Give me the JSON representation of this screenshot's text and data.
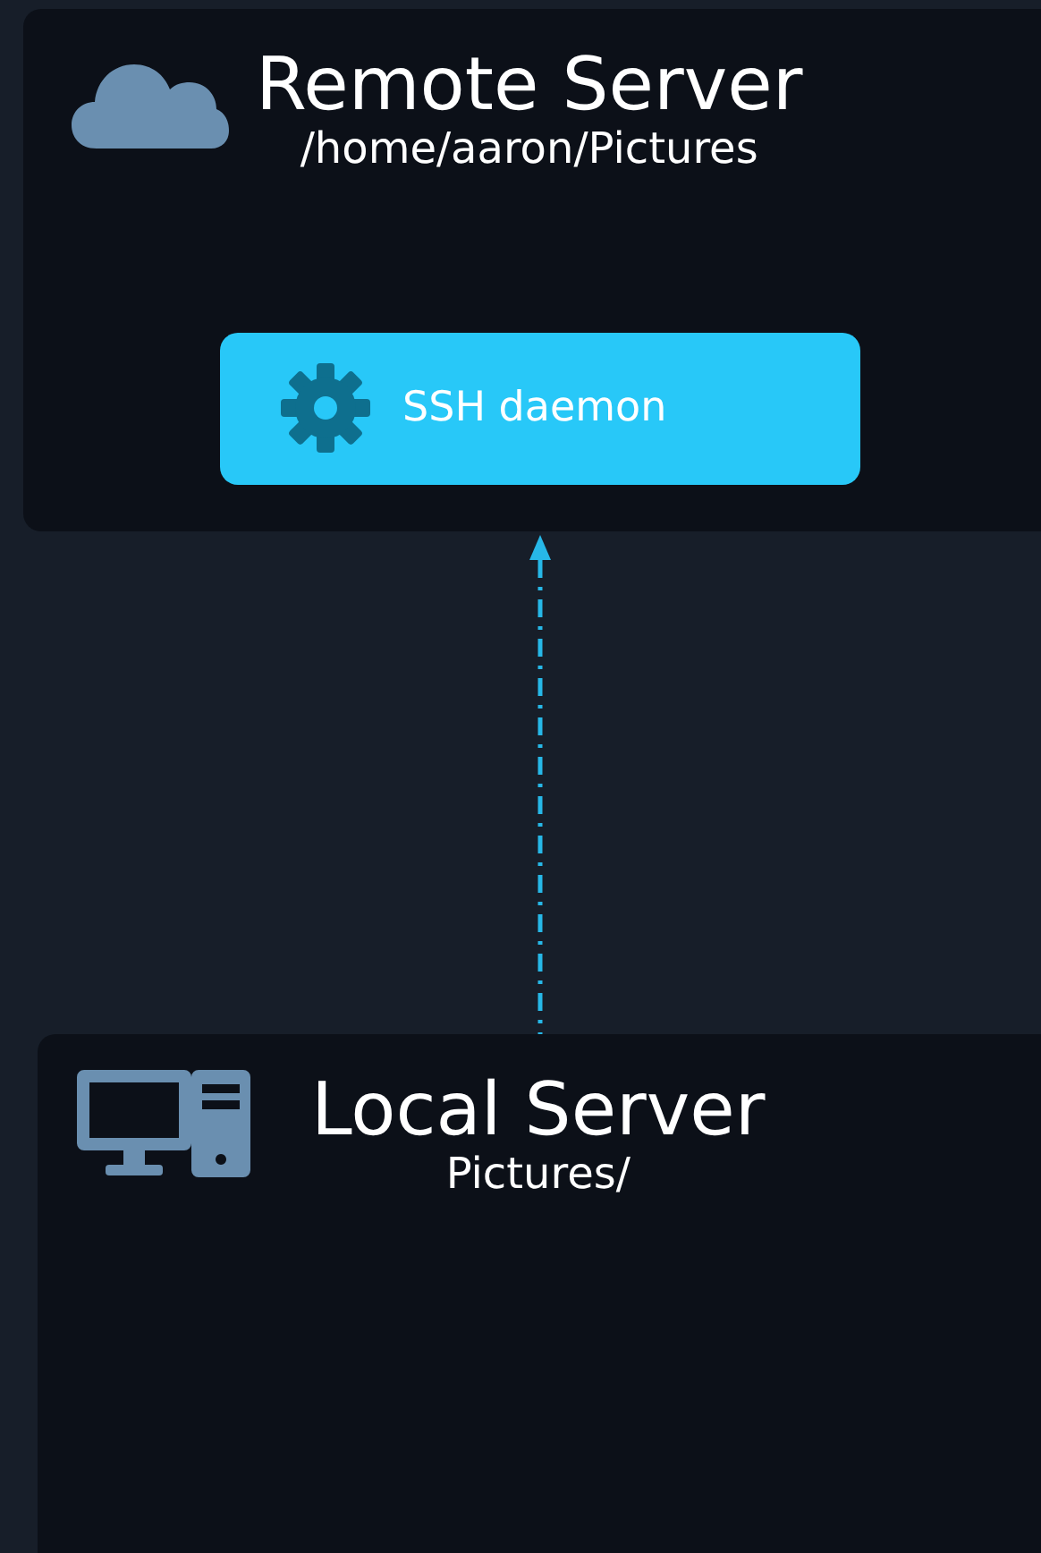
{
  "remote_server": {
    "title": "Remote Server",
    "path": "/home/aaron/Pictures",
    "service": {
      "label": "SSH daemon"
    }
  },
  "local_server": {
    "title": "Local Server",
    "path": "Pictures/"
  }
}
